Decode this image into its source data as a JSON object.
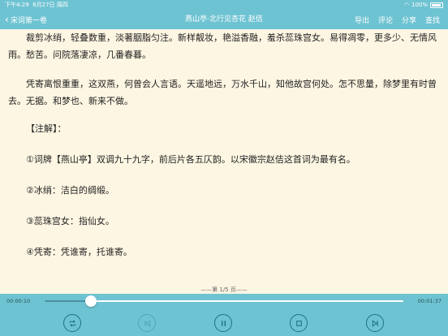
{
  "status": {
    "time": "下午4:29",
    "date": "6月27日 周四",
    "battery": "100%"
  },
  "nav": {
    "back_label": "宋词第一卷",
    "title": "燕山亭·北行见杏花 赵佶",
    "actions": [
      "导出",
      "评论",
      "分享",
      "查找"
    ]
  },
  "content": {
    "paragraphs": [
      "裁剪冰绡，轻叠数重，淡著胭脂匀注。新样靓妆，艳溢香融，羞杀蕊珠宫女。易得凋零，更多少、无情风雨。愁苦。问院落凄凉，几番春暮。",
      "凭寄离恨重重，这双燕，何曾会人言语。天遥地远，万水千山，知他故宫何处。怎不思量，除梦里有时曾去。无据。和梦也、新来不做。"
    ],
    "note_heading": "【注解】：",
    "notes": [
      "①词牌【燕山亭】双调九十九字，前后片各五仄韵。以宋徽宗赵佶这首词为最有名。",
      "②冰绡：洁白的绸缎。",
      "③蕊珠宫女：指仙女。",
      "④凭寄：凭谁寄，托谁寄。"
    ]
  },
  "page_indicator": "——第 1/5 页——",
  "player": {
    "current_time": "00:00:10",
    "total_time": "00:01:37",
    "progress": 0.13,
    "colors": {
      "bar": "#6ec3d2",
      "icon": "#1f6f85",
      "background": "#fdf6e3"
    },
    "controls": [
      {
        "icon": "repeat-icon",
        "enabled": true
      },
      {
        "icon": "skip-back-icon",
        "enabled": false
      },
      {
        "icon": "pause-icon",
        "enabled": true
      },
      {
        "icon": "stop-icon",
        "enabled": true
      },
      {
        "icon": "skip-forward-icon",
        "enabled": true
      }
    ]
  }
}
